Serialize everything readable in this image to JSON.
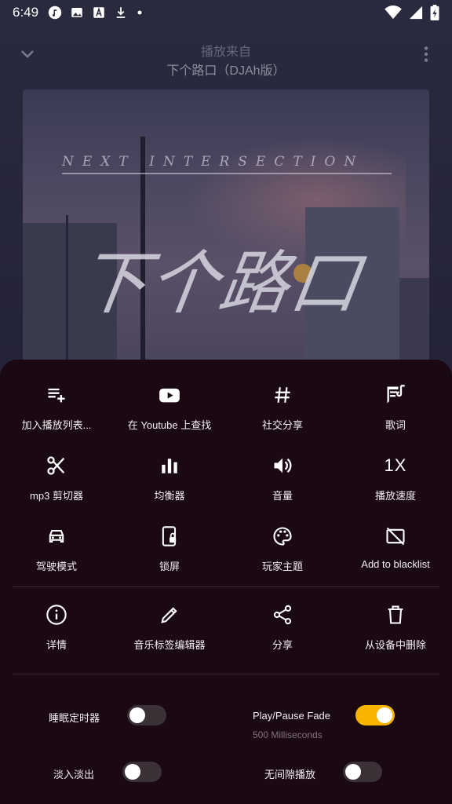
{
  "status_bar": {
    "time": "6:49",
    "icons": [
      "music-note-icon",
      "image-icon",
      "text-a-icon",
      "download-icon",
      "dot-icon"
    ],
    "right_icons": [
      "wifi-icon",
      "signal-icon",
      "battery-icon"
    ]
  },
  "player": {
    "from_label": "播放来自",
    "song_title": "下个路口（DJAh版）",
    "album_art": {
      "text_en": "NEXT INTERSECTION",
      "text_cn": "下个路口"
    }
  },
  "menu": {
    "items": [
      {
        "label": "加入播放列表...",
        "icon": "playlist-add-icon"
      },
      {
        "label": "在 Youtube 上查找",
        "icon": "youtube-icon"
      },
      {
        "label": "社交分享",
        "icon": "hashtag-icon"
      },
      {
        "label": "歌词",
        "icon": "lyrics-icon"
      },
      {
        "label": "mp3 剪切器",
        "icon": "scissors-icon"
      },
      {
        "label": "均衡器",
        "icon": "equalizer-icon"
      },
      {
        "label": "音量",
        "icon": "volume-icon"
      },
      {
        "label": "播放速度",
        "icon": "speed-icon",
        "value": "1X"
      },
      {
        "label": "驾驶模式",
        "icon": "car-icon"
      },
      {
        "label": "锁屏",
        "icon": "lock-screen-icon"
      },
      {
        "label": "玩家主题",
        "icon": "palette-icon"
      },
      {
        "label": "Add to blacklist",
        "icon": "blacklist-icon"
      }
    ],
    "items2": [
      {
        "label": "详情",
        "icon": "info-icon"
      },
      {
        "label": "音乐标签编辑器",
        "icon": "pencil-icon"
      },
      {
        "label": "分享",
        "icon": "share-icon"
      },
      {
        "label": "从设备中删除",
        "icon": "trash-icon"
      }
    ]
  },
  "toggles": {
    "sleep_timer": {
      "label": "睡眠定时器",
      "on": false
    },
    "play_pause_fade": {
      "label": "Play/Pause Fade",
      "sub": "500 Milliseconds",
      "on": true
    },
    "fade_in_out": {
      "label": "淡入淡出",
      "on": false
    },
    "gapless": {
      "label": "无间隙播放",
      "on": false
    }
  },
  "colors": {
    "sheet_bg": "#1a0812",
    "accent": "#f7b500"
  }
}
